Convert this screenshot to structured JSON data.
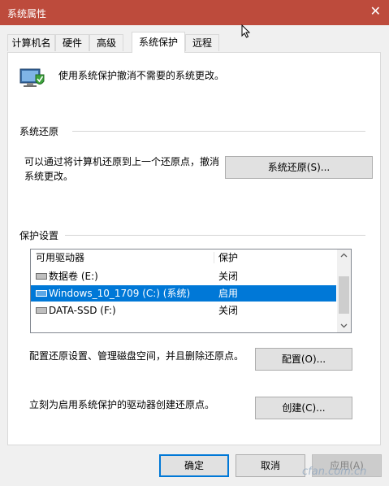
{
  "window": {
    "title": "系统属性",
    "close_glyph": "✕"
  },
  "tabs": [
    {
      "label": "计算机名"
    },
    {
      "label": "硬件"
    },
    {
      "label": "高级"
    },
    {
      "label": "系统保护"
    },
    {
      "label": "远程"
    }
  ],
  "active_tab": "系统保护",
  "intro": {
    "text": "使用系统保护撤消不需要的系统更改。",
    "icon": "computer-shield-icon"
  },
  "restore": {
    "heading": "系统还原",
    "description": "可以通过将计算机还原到上一个还原点，撤消系统更改。",
    "button": "系统还原(S)..."
  },
  "protection": {
    "heading": "保护设置",
    "columns": [
      "可用驱动器",
      "保护"
    ],
    "drives": [
      {
        "name": "数据卷 (E:)",
        "protection": "关闭",
        "selected": false,
        "icon": "drive-icon"
      },
      {
        "name": "Windows_10_1709 (C:) (系统)",
        "protection": "启用",
        "selected": true,
        "icon": "system-drive-icon"
      },
      {
        "name": "DATA-SSD (F:)",
        "protection": "关闭",
        "selected": false,
        "icon": "drive-icon"
      }
    ]
  },
  "configure": {
    "text": "配置还原设置、管理磁盘空间，并且删除还原点。",
    "button": "配置(O)..."
  },
  "create": {
    "text": "立刻为启用系统保护的驱动器创建还原点。",
    "button": "创建(C)..."
  },
  "footer": {
    "ok": "确定",
    "cancel": "取消",
    "apply": "应用(A)"
  },
  "watermark": "cfan.com.cn",
  "colors": {
    "titlebar": "#bd4b3c",
    "selection": "#0078d7",
    "button": "#e1e1e1"
  }
}
